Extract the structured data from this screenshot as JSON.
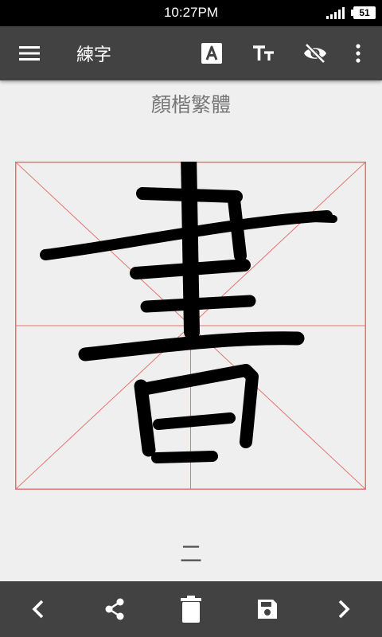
{
  "status_bar": {
    "time": "10:27PM",
    "battery": "51"
  },
  "app_bar": {
    "menu_icon": "menu-icon",
    "title": "練字",
    "actions": [
      "font-a-icon",
      "text-size-icon",
      "visibility-off-icon",
      "more-vert-icon"
    ]
  },
  "main": {
    "style_label": "顏楷繁體",
    "character": "書",
    "stroke_label": "二",
    "grid_color": "#e57373",
    "ink_color": "#000000"
  },
  "bottom_bar": {
    "actions": [
      "chevron-left-icon",
      "share-icon",
      "delete-icon",
      "save-icon",
      "chevron-right-icon"
    ]
  },
  "colors": {
    "bar": "#424242",
    "background": "#efefef",
    "status_bar": "#000000"
  }
}
